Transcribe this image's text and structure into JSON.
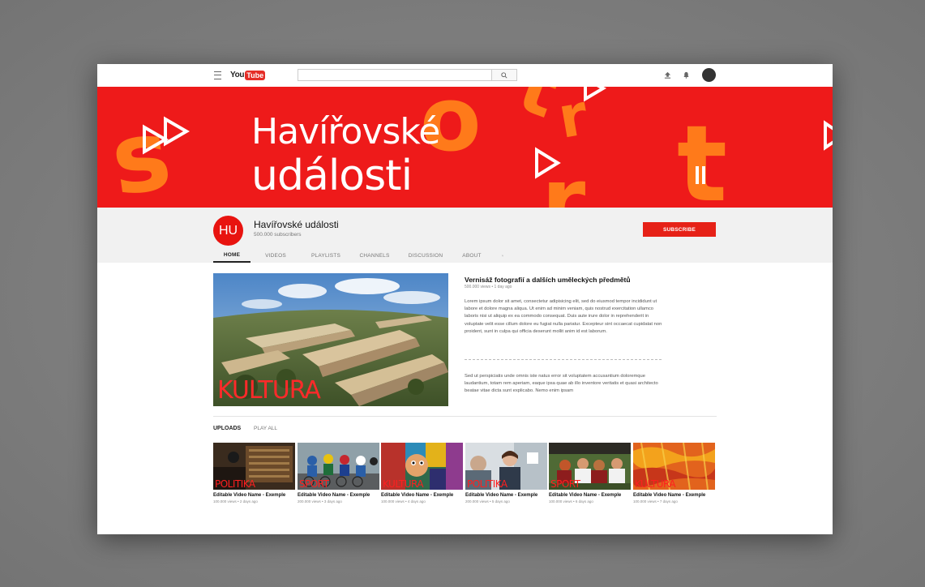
{
  "header": {
    "logo_you": "You",
    "logo_tube": "Tube",
    "search_placeholder": ""
  },
  "banner": {
    "line1": "Havířovské",
    "line2": "události",
    "bg_color": "#ee1a1a",
    "accent_color": "#ff7a00"
  },
  "channel": {
    "logo_text": "HU",
    "name": "Havířovské události",
    "subscribers": "500.000 subscribers",
    "subscribe_label": "SUBSCRIBE",
    "tabs": [
      {
        "label": "HOME",
        "active": true
      },
      {
        "label": "VIDEOS",
        "active": false
      },
      {
        "label": "PLAYLISTS",
        "active": false
      },
      {
        "label": "CHANNELS",
        "active": false
      },
      {
        "label": "DISCUSSION",
        "active": false
      },
      {
        "label": "ABOUT",
        "active": false
      }
    ]
  },
  "featured": {
    "category": "KULTURA",
    "title": "Vernisáž fotografií a dalších uměleckých předmětů",
    "meta": "500.000 views • 1 day ago",
    "desc1": "Lorem ipsum dolor sit amet, consectetur adipisicing elit, sed do eiusmod tempor incididunt ut labore et dolore magna aliqua. Ut enim ad minim veniam, quis nostrud exercitation ullamco laboris nisi ut aliquip ex ea commodo consequat. Duis aute irure dolor in reprehenderit in voluptate velit esse cillum dolore eu fugiat nulla pariatur. Excepteur sint occaecat cupidatat non proident, sunt in culpa qui officia deserunt mollit anim id est laborum.",
    "desc2": "Sed ut perspiciatis unde omnis iste natus error sit voluptatem accusantium doloremque laudantium, totam rem aperiam, eaque ipsa quae ab illo inventore veritatis et quasi architecto beatae vitae dicta sunt explicabo. Nemo enim ipsam"
  },
  "uploads": {
    "title": "UPLOADS",
    "play_all": "PLAY ALL",
    "videos": [
      {
        "category": "POLITIKA",
        "title": "Editable Video Name - Exemple",
        "meta": "100.000 views • 2 days ago"
      },
      {
        "category": "SPORT",
        "title": "Editable Video Name - Exemple",
        "meta": "200.000 views • 3 days ago"
      },
      {
        "category": "KULTURA",
        "title": "Editable Video Name - Exemple",
        "meta": "100.000 views • 4 days ago"
      },
      {
        "category": "POLITIKA",
        "title": "Editable Video Name - Exemple",
        "meta": "200.000 views • 5 days ago"
      },
      {
        "category": "SPORT",
        "title": "Editable Video Name - Exemple",
        "meta": "100.000 views • 6 days ago"
      },
      {
        "category": "KULTURA",
        "title": "Editable Video Name - Exemple",
        "meta": "100.000 views • 7 days ago"
      }
    ]
  }
}
